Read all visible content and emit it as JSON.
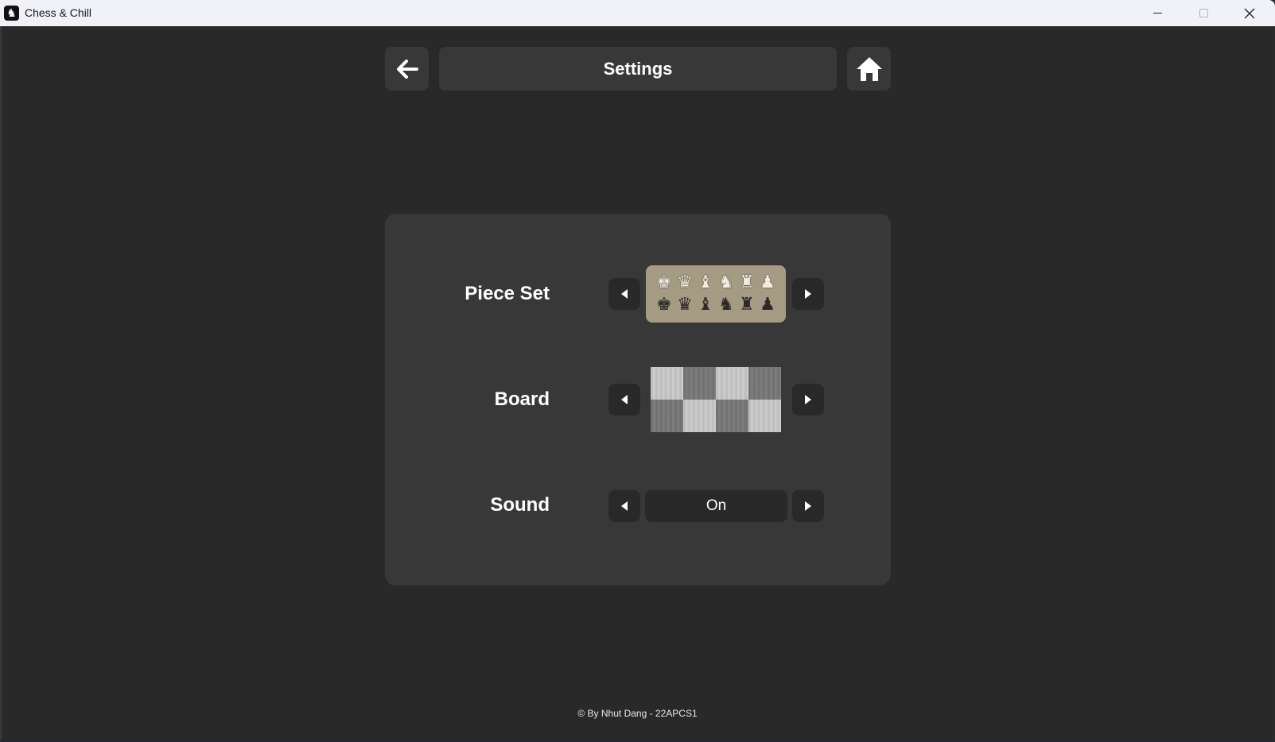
{
  "window": {
    "title": "Chess & Chill",
    "icons": {
      "app": "chess-knight-icon",
      "minimize": "minimize-icon",
      "maximize": "maximize-icon",
      "close": "close-icon"
    },
    "close_glyph": "✕",
    "app_glyph": "♞"
  },
  "header": {
    "title": "Settings",
    "back_icon": "arrow-left-icon",
    "home_icon": "home-icon"
  },
  "settings": {
    "piece_set": {
      "label": "Piece Set",
      "white_pieces": [
        "♚",
        "♛",
        "♝",
        "♞",
        "♜",
        "♟"
      ],
      "black_pieces": [
        "♚",
        "♛",
        "♝",
        "♞",
        "♜",
        "♟"
      ],
      "preview_bg": "#a59a82"
    },
    "board": {
      "label": "Board",
      "style": "grey wood"
    },
    "sound": {
      "label": "Sound",
      "value": "On"
    }
  },
  "footer": {
    "text": "© By Nhut Dang - 22APCS1"
  },
  "colors": {
    "background": "#292929",
    "panel": "#383838",
    "button": "#383838",
    "control": "#292929",
    "text": "#ffffff"
  }
}
